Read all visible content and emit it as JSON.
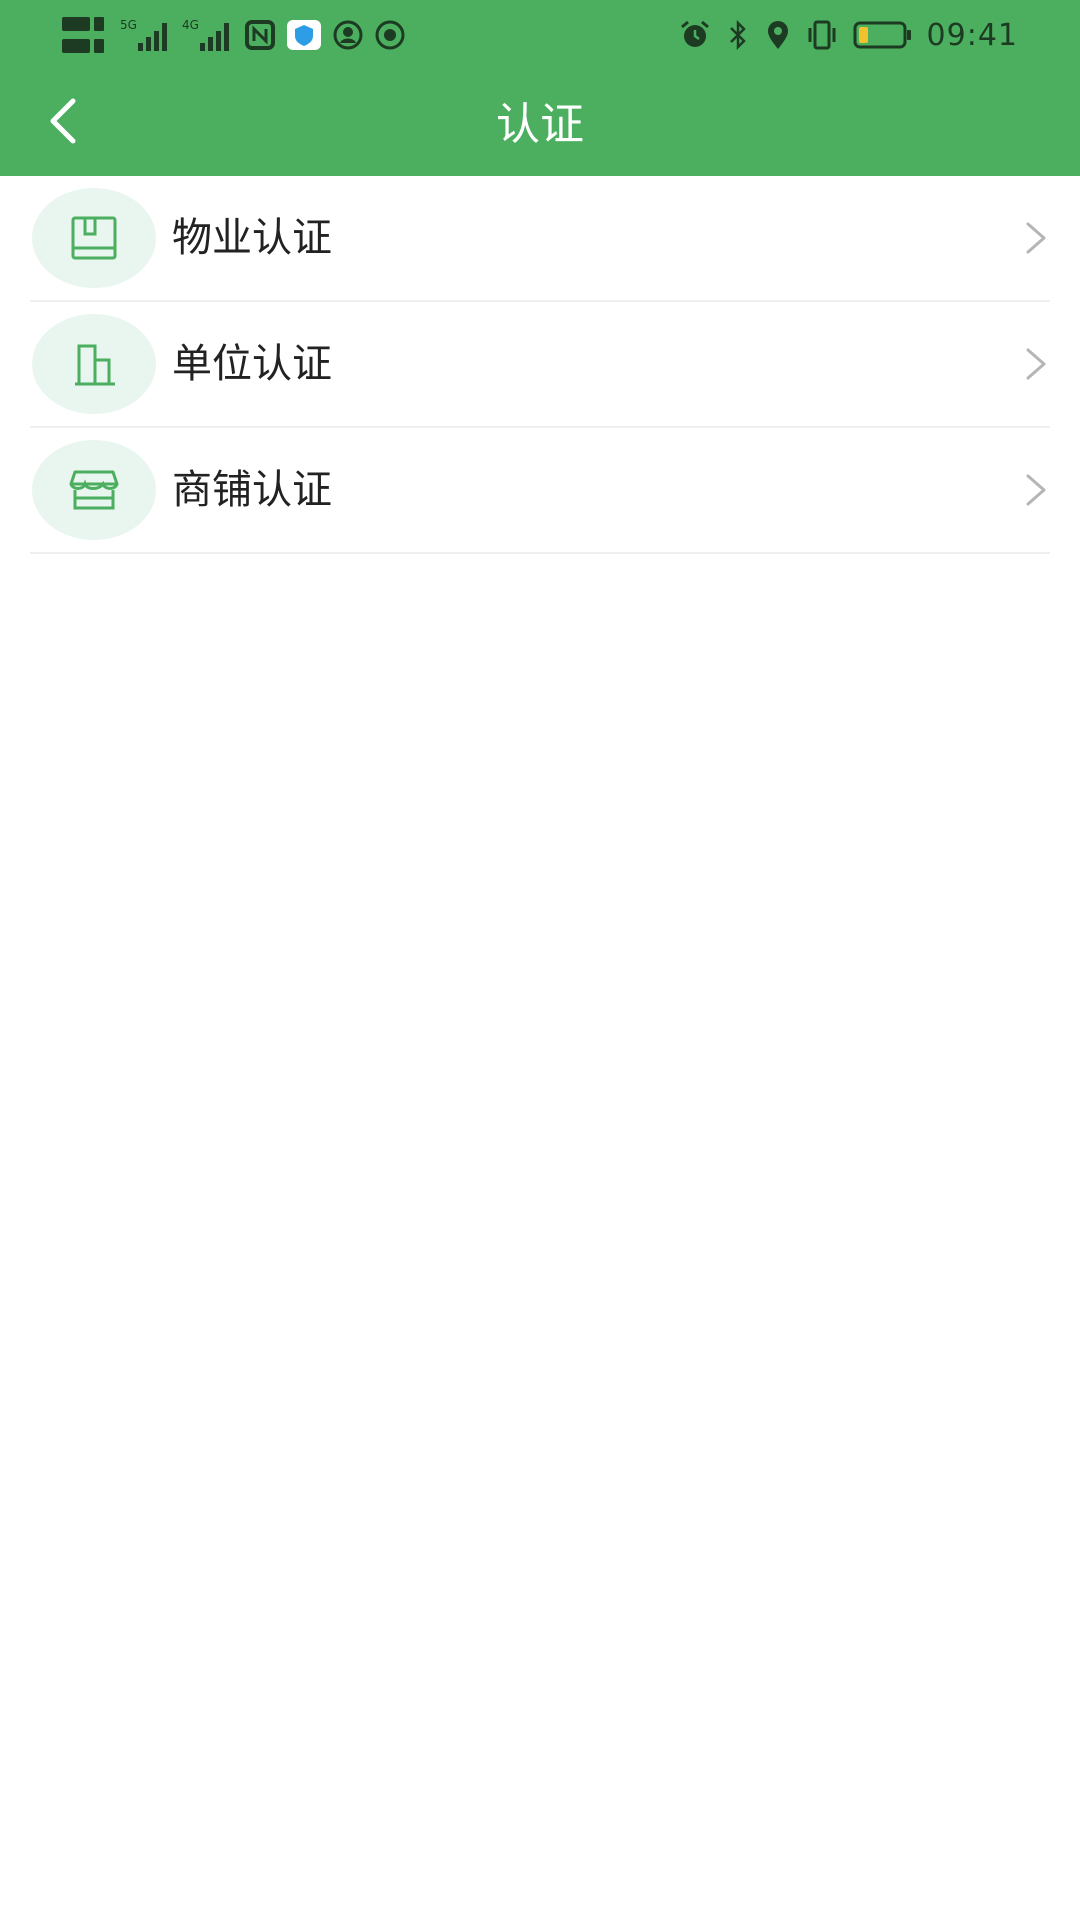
{
  "status_bar": {
    "time": "09:41",
    "left_icons": [
      "hd-sim-icon",
      "signal-5g-icon",
      "signal-4g-icon",
      "nfc-icon",
      "shield-app-icon",
      "avatar-app-icon",
      "record-app-icon"
    ],
    "right_icons": [
      "alarm-icon",
      "bluetooth-icon",
      "location-icon",
      "vibrate-icon",
      "battery-icon"
    ]
  },
  "toolbar": {
    "title": "认证",
    "back_icon": "chevron-left-icon"
  },
  "list": {
    "items": [
      {
        "label": "物业认证",
        "icon": "property-card-icon"
      },
      {
        "label": "单位认证",
        "icon": "building-icon"
      },
      {
        "label": "商铺认证",
        "icon": "storefront-icon"
      }
    ]
  },
  "colors": {
    "appbar": "#4caf5f",
    "icon_bg": "#e9f6ef",
    "icon_stroke": "#4caf5f",
    "chevron": "#b5b5b5",
    "divider": "#efefef"
  }
}
